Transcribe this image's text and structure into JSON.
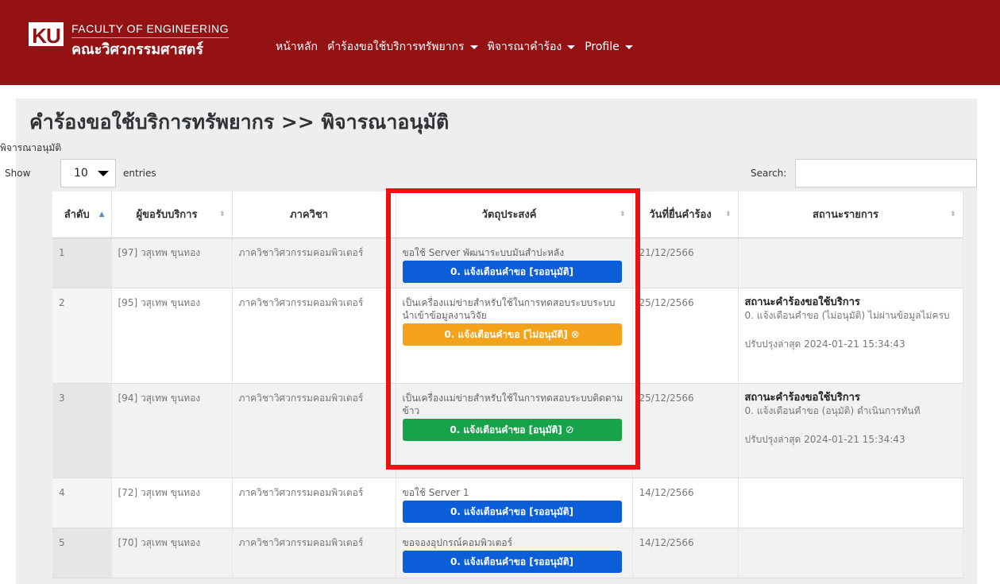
{
  "header": {
    "logo_text": "KU",
    "brand_en": "FACULTY OF ENGINEERING",
    "brand_th": "คณะวิศวกรรมศาสตร์",
    "nav": [
      {
        "label": "หน้าหลัก",
        "dropdown": false
      },
      {
        "label": "คำร้องขอใช้บริการทรัพยากร",
        "dropdown": true
      },
      {
        "label": "พิจารณาคำร้อง",
        "dropdown": true
      },
      {
        "label": "Profile",
        "dropdown": true
      }
    ],
    "bg_color": "#941214"
  },
  "page": {
    "title": "คำร้องขอใช้บริการทรัพยากร >> พิจารณาอนุมัติ",
    "breadcrumb": "พิจารณาอนุมัติ"
  },
  "controls": {
    "show_label": "Show",
    "length_value": "10",
    "entries_label": "entries",
    "search_label": "Search:",
    "search_value": ""
  },
  "table": {
    "columns": [
      "ลำดับ",
      "ผู้ขอรับบริการ",
      "ภาควิชา",
      "วัตถุประสงค์",
      "วันที่ยื่นคำร้อง",
      "สถานะรายการ"
    ],
    "rows": [
      {
        "no": "1",
        "requester": "[97] วสุเทพ ขุนทอง",
        "department": "ภาควิชาวิศวกรรมคอมพิวเตอร์",
        "purpose": "ขอใช้ Server พัฒนาระบบมันสำปะหลัง",
        "badge": "0. แจ้งเตือนคำขอ [รออนุมัติ]",
        "badge_icon": "",
        "badge_color": "#0b5ed7",
        "date": "21/12/2566",
        "status_title": "",
        "status_desc": "",
        "status_updated": ""
      },
      {
        "no": "2",
        "requester": "[95] วสุเทพ ขุนทอง",
        "department": "ภาควิชาวิศวกรรมคอมพิวเตอร์",
        "purpose": "เป็นเครื่องแม่ข่ายสำหรับใช้ในการทดสอบระบบระบบนำเข้าข้อมูลงานวิจัย",
        "badge": "0. แจ้งเตือนคำขอ [ไม่อนุมัติ]",
        "badge_icon": "⊗",
        "badge_color": "#f5a21b",
        "date": "25/12/2566",
        "status_title": "สถานะคำร้องขอใช้บริการ",
        "status_desc": "0. แจ้งเตือนคำขอ (ไม่อนุมัติ) ไม่ผ่านข้อมูลไม่ครบ",
        "status_updated": "ปรับปรุงล่าสุด 2024-01-21 15:34:43"
      },
      {
        "no": "3",
        "requester": "[94] วสุเทพ ขุนทอง",
        "department": "ภาควิชาวิศวกรรมคอมพิวเตอร์",
        "purpose": "เป็นเครื่องแม่ข่ายสำหรับใช้ในการทดสอบระบบติดตามข้าว",
        "badge": "0. แจ้งเตือนคำขอ [อนุมัติ]",
        "badge_icon": "⊘",
        "badge_color": "#16a34a",
        "date": "25/12/2566",
        "status_title": "สถานะคำร้องขอใช้บริการ",
        "status_desc": "0. แจ้งเตือนคำขอ (อนุมัติ) ดำเนินการทันที",
        "status_updated": "ปรับปรุงล่าสุด 2024-01-21 15:34:43"
      },
      {
        "no": "4",
        "requester": "[72] วสุเทพ ขุนทอง",
        "department": "ภาควิชาวิศวกรรมคอมพิวเตอร์",
        "purpose": "ขอใช้ Server 1",
        "badge": "0. แจ้งเตือนคำขอ [รออนุมัติ]",
        "badge_icon": "",
        "badge_color": "#0b5ed7",
        "date": "14/12/2566",
        "status_title": "",
        "status_desc": "",
        "status_updated": ""
      },
      {
        "no": "5",
        "requester": "[70] วสุเทพ ขุนทอง",
        "department": "ภาควิชาวิศวกรรมคอมพิวเตอร์",
        "purpose": "ขอจองอุปกรณ์คอมพิวเตอร์",
        "badge": "0. แจ้งเตือนคำขอ [รออนุมัติ]",
        "badge_icon": "",
        "badge_color": "#0b5ed7",
        "date": "14/12/2566",
        "status_title": "",
        "status_desc": "",
        "status_updated": ""
      }
    ]
  },
  "highlight_color": "#ee1111"
}
